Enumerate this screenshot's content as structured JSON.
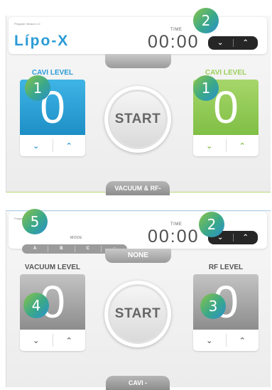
{
  "panel1": {
    "version_text": "Program Version 1.0",
    "logo_text": "Lípo-X",
    "time_label": "TIME",
    "time_value": "00:00",
    "top_tab": "",
    "bottom_tab": "VACUUM & RF-",
    "left": {
      "label": "CAVI LEVEL",
      "value": "0",
      "color": "#2a9bd6"
    },
    "right": {
      "label": "CAVI LEVEL",
      "value": "0",
      "color": "#9bcf5a"
    },
    "start_label": "START",
    "time_down_icon": "chevron-down-icon",
    "time_up_icon": "chevron-up-icon",
    "badges": {
      "left": "1",
      "right": "1",
      "time": "2"
    }
  },
  "panel2": {
    "version_text": "Program Version 1.0",
    "mode_label": "MODE",
    "modes": [
      "A",
      "B",
      "C",
      "○"
    ],
    "time_label": "TIME",
    "time_value": "00:00",
    "top_tab": "NONE",
    "bottom_tab": "CAVI -",
    "left": {
      "label": "VACUUM LEVEL",
      "value": "0"
    },
    "right": {
      "label": "RF LEVEL",
      "value": "0"
    },
    "start_label": "START",
    "badges": {
      "mode": "5",
      "time": "2",
      "left": "4",
      "right": "3"
    }
  },
  "arrows": {
    "down": "⌄",
    "up": "⌃"
  },
  "colors": {
    "blue": "#2a9bd6",
    "green": "#8bc850",
    "dark_pill": "#262626"
  }
}
